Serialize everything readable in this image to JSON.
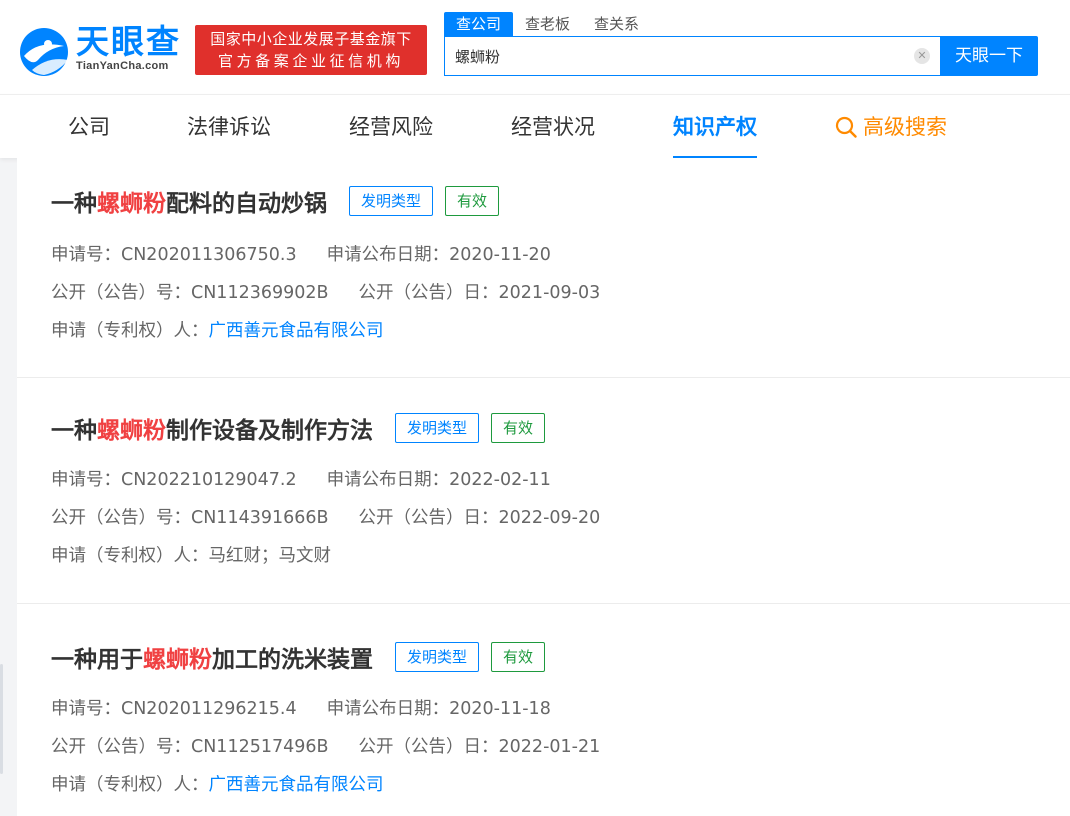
{
  "header": {
    "logo_text": "天眼查",
    "logo_sub": "TianYanCha.com",
    "badge_line1": "国家中小企业发展子基金旗下",
    "badge_line2": "官方备案企业征信机构",
    "search_tabs": [
      "查公司",
      "查老板",
      "查关系"
    ],
    "search_value": "螺蛳粉",
    "search_button": "天眼一下"
  },
  "nav": {
    "items": [
      "公司",
      "法律诉讼",
      "经营风险",
      "经营状况",
      "知识产权"
    ],
    "advanced": "高级搜索"
  },
  "labels": {
    "app_no": "申请号：",
    "pub_date": "申请公布日期：",
    "open_no": "公开（公告）号：",
    "open_date": "公开（公告）日：",
    "applicant": "申请（专利权）人："
  },
  "results": [
    {
      "title_pre": "一种",
      "title_hl": "螺蛳粉",
      "title_post": "配料的自动炒锅",
      "tag_type": "发明类型",
      "tag_status": "有效",
      "app_no": "CN202011306750.3",
      "pub_date": "2020-11-20",
      "open_no": "CN112369902B",
      "open_date": "2021-09-03",
      "applicant": "广西善元食品有限公司"
    },
    {
      "title_pre": "一种",
      "title_hl": "螺蛳粉",
      "title_post": "制作设备及制作方法",
      "tag_type": "发明类型",
      "tag_status": "有效",
      "app_no": "CN202210129047.2",
      "pub_date": "2022-02-11",
      "open_no": "CN114391666B",
      "open_date": "2022-09-20",
      "applicant": "马红财；马文财"
    },
    {
      "title_pre": "一种用于",
      "title_hl": "螺蛳粉",
      "title_post": "加工的洗米装置",
      "tag_type": "发明类型",
      "tag_status": "有效",
      "app_no": "CN202011296215.4",
      "pub_date": "2020-11-18",
      "open_no": "CN112517496B",
      "open_date": "2022-01-21",
      "applicant": "广西善元食品有限公司"
    }
  ],
  "colors": {
    "brand": "#0084ff",
    "highlight": "#f04142",
    "valid": "#1e9a3e",
    "advanced": "#ff8a00",
    "badge": "#e0302c"
  }
}
